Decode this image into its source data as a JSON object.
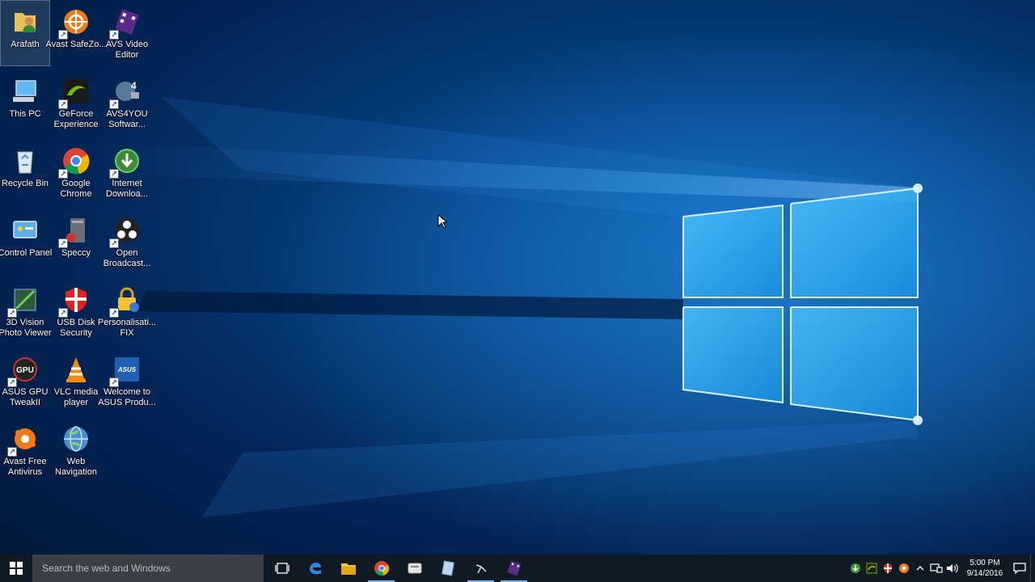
{
  "desktop": {
    "icons": [
      {
        "label": "Arafath",
        "icon": "user-folder-icon"
      },
      {
        "label": "This PC",
        "icon": "computer-icon"
      },
      {
        "label": "Recycle Bin",
        "icon": "recycle-bin-icon"
      },
      {
        "label": "Control Panel",
        "icon": "control-panel-icon"
      },
      {
        "label": "3D Vision Photo Viewer",
        "icon": "3d-vision-icon"
      },
      {
        "label": "ASUS GPU TweakII",
        "icon": "asus-gpu-tweak-icon"
      },
      {
        "label": "Avast Free Antivirus",
        "icon": "avast-icon"
      },
      {
        "label": "Avast SafeZo...",
        "icon": "avast-safezone-icon"
      },
      {
        "label": "GeForce Experience",
        "icon": "geforce-icon"
      },
      {
        "label": "Google Chrome",
        "icon": "chrome-icon"
      },
      {
        "label": "Speccy",
        "icon": "speccy-icon"
      },
      {
        "label": "USB Disk Security",
        "icon": "usb-disk-security-icon"
      },
      {
        "label": "VLC media player",
        "icon": "vlc-icon"
      },
      {
        "label": "Web Navigation",
        "icon": "web-navigation-icon"
      },
      {
        "label": "AVS Video Editor",
        "icon": "avs-video-editor-icon"
      },
      {
        "label": "AVS4YOU Softwar...",
        "icon": "avs4you-icon"
      },
      {
        "label": "Internet Downloa...",
        "icon": "internet-download-manager-icon"
      },
      {
        "label": "Open Broadcast...",
        "icon": "obs-icon"
      },
      {
        "label": "Personalisati... FIX",
        "icon": "personalisation-fix-icon"
      },
      {
        "label": "Welcome to ASUS Produ...",
        "icon": "asus-welcome-icon"
      }
    ]
  },
  "taskbar": {
    "search_placeholder": "Search the web and Windows",
    "pinned": [
      {
        "name": "task-view",
        "icon": "task-view-icon"
      },
      {
        "name": "edge",
        "icon": "edge-icon"
      },
      {
        "name": "file-explorer",
        "icon": "folder-icon"
      },
      {
        "name": "chrome",
        "icon": "chrome-icon"
      },
      {
        "name": "app-5",
        "icon": "generic-app-icon"
      },
      {
        "name": "app-6",
        "icon": "notebook-icon"
      },
      {
        "name": "app-7",
        "icon": "obs-icon"
      },
      {
        "name": "avs-video-editor",
        "icon": "avs-video-editor-icon"
      }
    ],
    "tray": {
      "time": "5:00 PM",
      "date": "9/14/2016",
      "icons": [
        "idm-tray-icon",
        "nvidia-tray-icon",
        "usb-security-tray-icon",
        "avast-tray-icon",
        "chevron-up-icon",
        "network-icon",
        "volume-icon"
      ]
    }
  },
  "colors": {
    "accent": "#76b9ed",
    "taskbar_bg": "#101a24",
    "search_bg": "#3a3f45"
  }
}
